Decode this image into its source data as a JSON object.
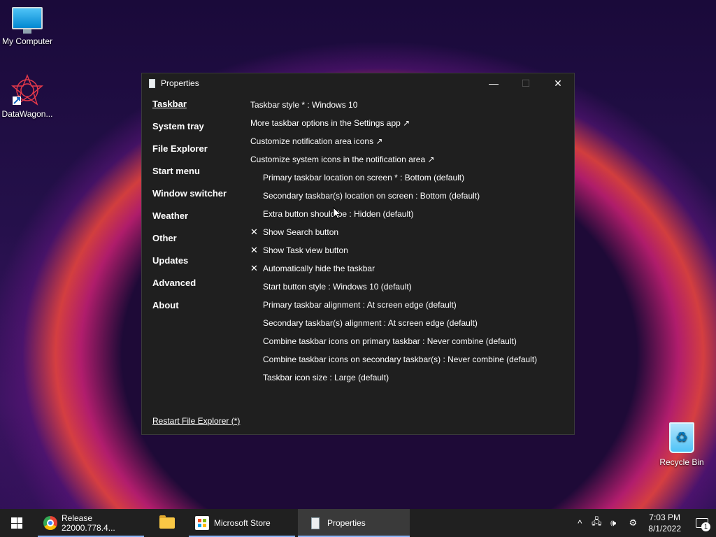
{
  "desktop": {
    "icons": [
      {
        "label": "My Computer",
        "icon": "computer-icon"
      },
      {
        "label": "DataWagon...",
        "icon": "datawagon-icon"
      },
      {
        "label": "Recycle Bin",
        "icon": "recycle-bin-icon"
      }
    ]
  },
  "window": {
    "title": "Properties",
    "minimize_glyph": "—",
    "maximize_glyph": "☐",
    "close_glyph": "✕",
    "nav": [
      {
        "label": "Taskbar",
        "active": true
      },
      {
        "label": "System tray"
      },
      {
        "label": "File Explorer"
      },
      {
        "label": "Start menu"
      },
      {
        "label": "Window switcher"
      },
      {
        "label": "Weather"
      },
      {
        "label": "Other"
      },
      {
        "label": "Updates"
      },
      {
        "label": "Advanced"
      },
      {
        "label": "About"
      }
    ],
    "settings": [
      {
        "text": "Taskbar style * : Windows 10",
        "indent": false,
        "checked": false
      },
      {
        "text": "More taskbar options in the Settings app ↗",
        "indent": false,
        "checked": false
      },
      {
        "text": "Customize notification area icons ↗",
        "indent": false,
        "checked": false
      },
      {
        "text": "Customize system icons in the notification area ↗",
        "indent": false,
        "checked": false
      },
      {
        "text": "Primary taskbar location on screen * : Bottom (default)",
        "indent": true,
        "checked": false
      },
      {
        "text": "Secondary taskbar(s) location on screen : Bottom (default)",
        "indent": true,
        "checked": false
      },
      {
        "text": "Extra button should be : Hidden (default)",
        "indent": true,
        "checked": false
      },
      {
        "text": "Show Search button",
        "indent": false,
        "checked": true
      },
      {
        "text": "Show Task view button",
        "indent": false,
        "checked": true
      },
      {
        "text": "Automatically hide the taskbar",
        "indent": false,
        "checked": true
      },
      {
        "text": "Start button style : Windows 10 (default)",
        "indent": true,
        "checked": false
      },
      {
        "text": "Primary taskbar alignment : At screen edge (default)",
        "indent": true,
        "checked": false
      },
      {
        "text": "Secondary taskbar(s) alignment : At screen edge (default)",
        "indent": true,
        "checked": false
      },
      {
        "text": "Combine taskbar icons on primary taskbar : Never combine (default)",
        "indent": true,
        "checked": false
      },
      {
        "text": "Combine taskbar icons on secondary taskbar(s) : Never combine (default)",
        "indent": true,
        "checked": false
      },
      {
        "text": "Taskbar icon size : Large (default)",
        "indent": true,
        "checked": false
      }
    ],
    "check_glyph": "✕",
    "restart_label": "Restart File Explorer (*)"
  },
  "taskbar": {
    "items": [
      {
        "label": "Release 22000.778.4...",
        "icon": "chrome-icon"
      },
      {
        "label": "",
        "icon": "file-explorer-icon"
      },
      {
        "label": "Microsoft Store",
        "icon": "store-icon"
      },
      {
        "label": "Properties",
        "icon": "properties-icon"
      }
    ],
    "tray": {
      "chevron": "^",
      "network": "🖧",
      "volume": "🕪",
      "settings": "⚙",
      "time": "7:03 PM",
      "date": "8/1/2022",
      "notification_count": "1"
    }
  }
}
